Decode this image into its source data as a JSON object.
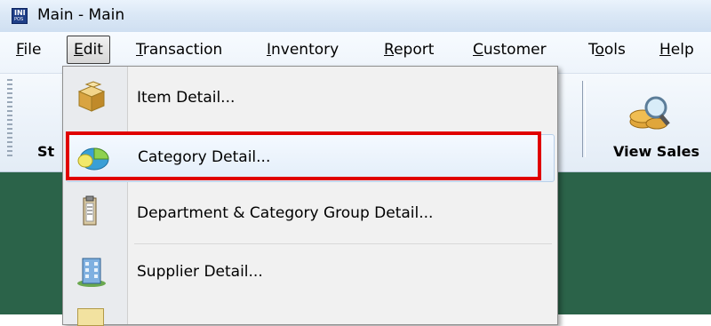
{
  "window": {
    "title": "Main - Main",
    "app_icon_text_top": "INI",
    "app_icon_text_bottom": "POS"
  },
  "menubar": {
    "items": [
      {
        "label": "File",
        "mnemonic": "F",
        "rest": "ile"
      },
      {
        "label": "Edit",
        "mnemonic": "E",
        "rest": "dit"
      },
      {
        "label": "Transaction",
        "mnemonic": "T",
        "rest": "ransaction"
      },
      {
        "label": "Inventory",
        "mnemonic": "I",
        "rest": "nventory"
      },
      {
        "label": "Report",
        "mnemonic": "R",
        "rest": "eport"
      },
      {
        "label": "Customer",
        "mnemonic": "C",
        "rest": "ustomer"
      },
      {
        "label": "Tools",
        "pre": "T",
        "mnemonic": "o",
        "rest": "ols"
      },
      {
        "label": "Help",
        "mnemonic": "H",
        "rest": "elp"
      }
    ]
  },
  "toolbar": {
    "left_label": "St",
    "right_label": "View Sales"
  },
  "edit_menu": {
    "items": [
      {
        "label": "Item Detail...",
        "icon": "boxes-icon"
      },
      {
        "label": "Category Detail...",
        "icon": "pie-chart-icon",
        "highlighted": true
      },
      {
        "label": "Department & Category Group Detail...",
        "icon": "clipboard-icon"
      },
      {
        "label": "Supplier Detail...",
        "icon": "building-icon"
      }
    ]
  },
  "colors": {
    "workspace": "#2b6349",
    "highlight_border": "#e00000",
    "titlebar": "#dbe8f6"
  }
}
